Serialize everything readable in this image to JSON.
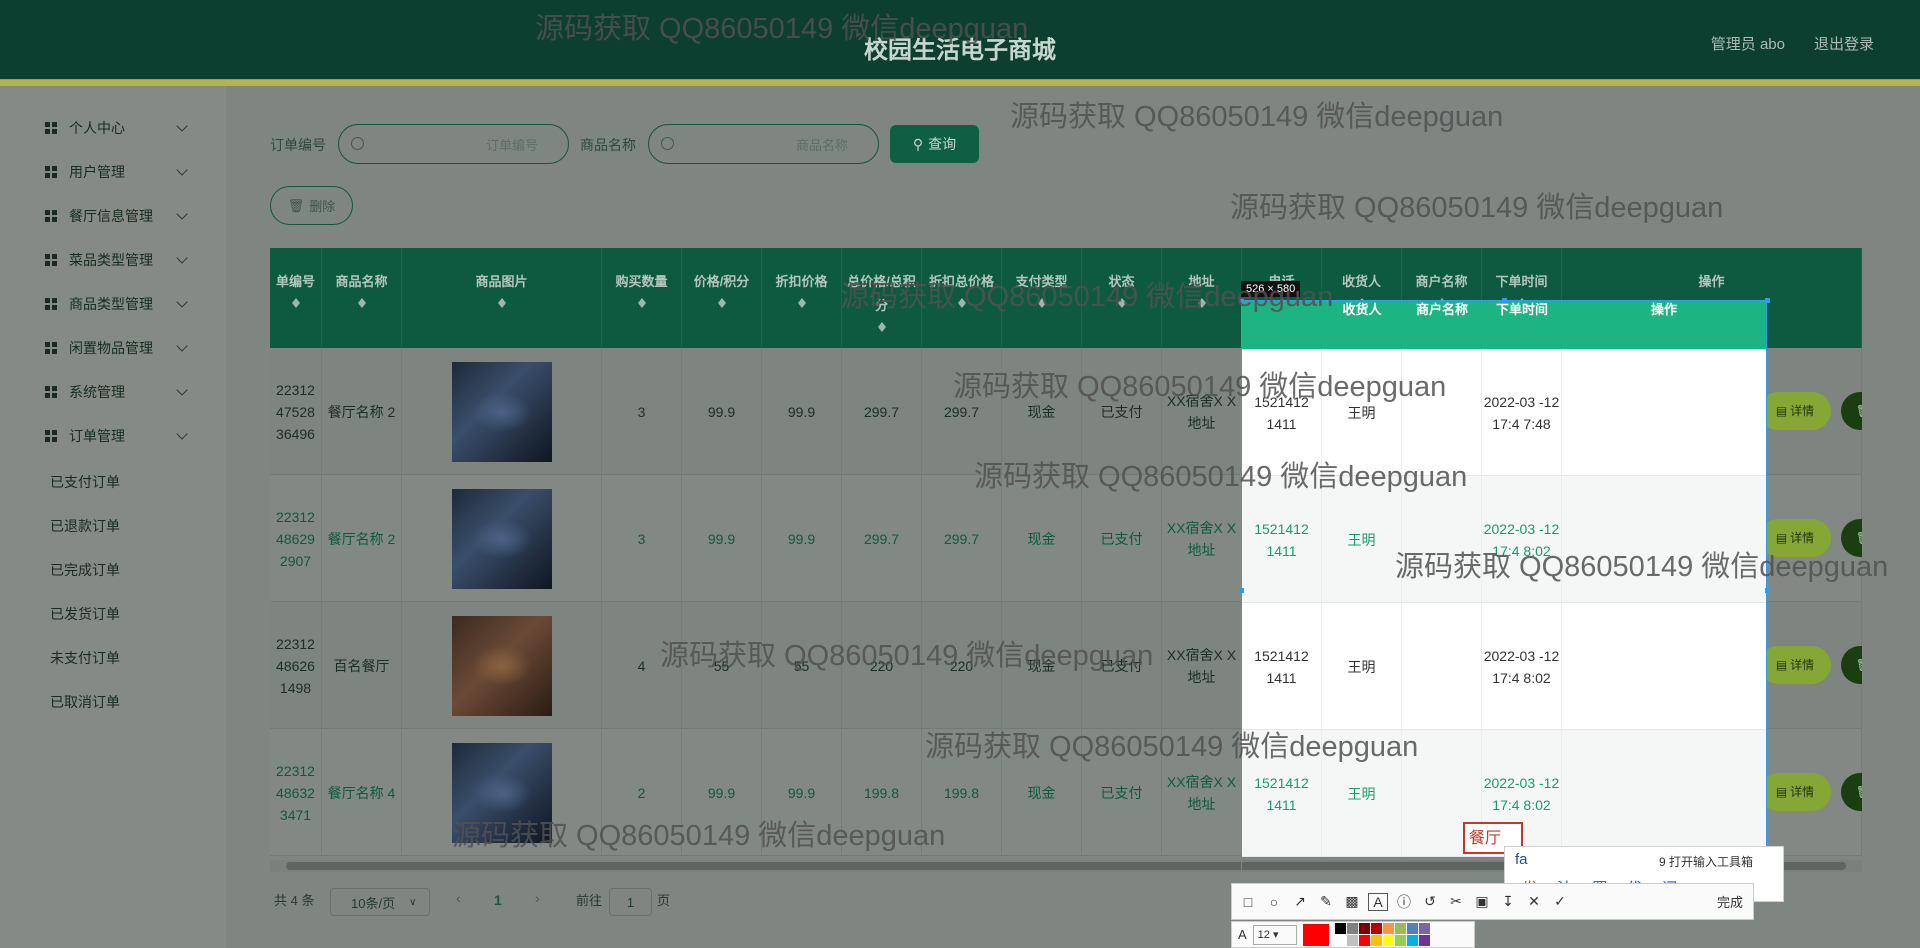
{
  "header": {
    "title": "校园生活电子商城",
    "admin": "管理员 abo",
    "logout": "退出登录"
  },
  "sidebar": {
    "items": [
      {
        "label": "个人中心",
        "icon": "user-icon"
      },
      {
        "label": "用户管理",
        "icon": "grid-icon"
      },
      {
        "label": "餐厅信息管理",
        "icon": "clipboard-icon"
      },
      {
        "label": "菜品类型管理",
        "icon": "bow-icon"
      },
      {
        "label": "商品类型管理",
        "icon": "grid-icon"
      },
      {
        "label": "闲置物品管理",
        "icon": "grid-icon"
      },
      {
        "label": "系统管理",
        "icon": "grid-icon"
      },
      {
        "label": "订单管理",
        "icon": "grid-icon"
      }
    ],
    "sub_items": [
      "已支付订单",
      "已退款订单",
      "已完成订单",
      "已发货订单",
      "未支付订单",
      "已取消订单"
    ]
  },
  "search": {
    "order_label": "订单编号",
    "order_placeholder": "订单编号",
    "product_label": "商品名称",
    "product_placeholder": "商品名称",
    "query_button": "查询",
    "delete_button": "删除"
  },
  "table": {
    "headers": [
      "单编号",
      "商品名称",
      "商品图片",
      "购买数量",
      "价格/积分",
      "折扣价格",
      "总价格/总积分",
      "折扣总价格",
      "支付类型",
      "状态",
      "地址",
      "电话",
      "收货人",
      "商户名称",
      "下单时间",
      "操作"
    ],
    "rows": [
      {
        "order_no": "22312 47528 36496",
        "name": "餐厅名称 2",
        "qty": "3",
        "price": "99.9",
        "discount": "99.9",
        "total": "299.7",
        "disc_total": "299.7",
        "pay": "现金",
        "status": "已支付",
        "addr": "XX宿舍X X地址",
        "phone": "1521412 1411",
        "receiver": "王明",
        "merchant": "",
        "time": "2022-03 -12 17:4 7:48"
      },
      {
        "order_no": "22312 48629 2907",
        "name": "餐厅名称 2",
        "qty": "3",
        "price": "99.9",
        "discount": "99.9",
        "total": "299.7",
        "disc_total": "299.7",
        "pay": "现金",
        "status": "已支付",
        "addr": "XX宿舍X X地址",
        "phone": "1521412 1411",
        "receiver": "王明",
        "merchant": "",
        "time": "2022-03 -12 17:4 8:02"
      },
      {
        "order_no": "22312 48626 1498",
        "name": "百名餐厅",
        "qty": "4",
        "price": "55",
        "discount": "55",
        "total": "220",
        "disc_total": "220",
        "pay": "现金",
        "status": "已支付",
        "addr": "XX宿舍X X地址",
        "phone": "1521412 1411",
        "receiver": "王明",
        "merchant": "",
        "time": "2022-03 -12 17:4 8:02"
      },
      {
        "order_no": "22312 48632 3471",
        "name": "餐厅名称 4",
        "qty": "2",
        "price": "99.9",
        "discount": "99.9",
        "total": "199.8",
        "disc_total": "199.8",
        "pay": "现金",
        "status": "已支付",
        "addr": "XX宿舍X X地址",
        "phone": "1521412 1411",
        "receiver": "王明",
        "merchant": "",
        "time": "2022-03 -12 17:4 8:02"
      }
    ],
    "detail_label": "详情",
    "delete_label": "删除"
  },
  "pagination": {
    "total": "共 4 条",
    "page_size": "10条/页",
    "current": "1",
    "goto_label": "前往",
    "goto_value": "1",
    "page_suffix": "页"
  },
  "overlay": {
    "size_label": "526 × 580",
    "ime_typed": "fa",
    "ime_tool": "9 打开输入工具箱",
    "ime_candidates": [
      "1发",
      "2法",
      "3罚",
      "4伐",
      "5阀"
    ],
    "ime_box_text": "餐厅",
    "toolbar_done": "完成",
    "font_size": "12"
  },
  "watermark": "源码获取 QQ86050149 微信deepguan",
  "colors": {
    "header": "#0d3f31",
    "primary": "#1db483",
    "accent": "#c9c23a"
  }
}
